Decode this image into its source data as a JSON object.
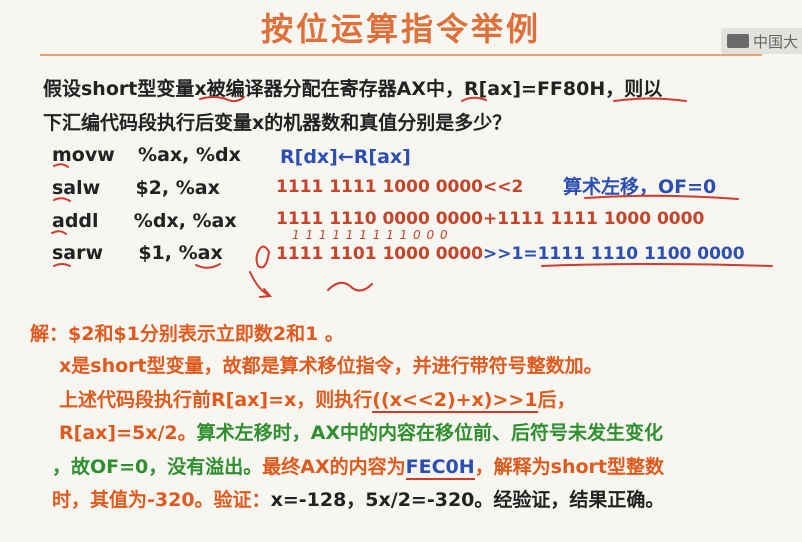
{
  "title": "按位运算指令举例",
  "logo_text": "中国大",
  "question": {
    "line1": "假设short型变量x被编译器分配在寄存器AX中，R[ax]=FF80H，则以",
    "line2": "下汇编代码段执行后变量x的机器数和真值分别是多少？"
  },
  "code": [
    {
      "op": "movw",
      "args": "%ax, %dx"
    },
    {
      "op": "salw",
      "args": "$2, %ax"
    },
    {
      "op": "addl",
      "args": "%dx, %ax"
    },
    {
      "op": "sarw",
      "args": "$1, %ax"
    }
  ],
  "explain": {
    "movw": "R[dx]←R[ax]",
    "salw": "1111 1111 1000 0000<<2",
    "salw_note": "算术左移，OF=0",
    "addl": "1111 1110 0000 0000+1111 1111 1000 0000",
    "sarw_left": "1111 1101 1000 0000",
    "sarw_op": ">>1=",
    "sarw_result": "1111 1110 1100 0000",
    "handwritten": "1 1 1 1 1 1 1 1 1 0 0 0"
  },
  "solution": {
    "line1": "解：$2和$1分别表示立即数2和1 。",
    "line2": "x是short型变量，故都是算术移位指令，并进行带符号整数加。",
    "line3_a": "上述代码段执行前R[ax]=x，则执行",
    "line3_b": "((x<<2)+x)>>1",
    "line3_c": "后，",
    "line4_a": "R[ax]=5x/2。",
    "line4_b": "算术左移时，AX中的内容在移位前、后符号未发生变化",
    "line5_a": "，故OF=0，没有溢出。",
    "line5_b": "最终AX的内容为",
    "line5_c": "FEC0H",
    "line5_d": "，解释为short型整数",
    "line6_a": "时，其值为-320。验证：",
    "line6_b": "x=-128，5x/2=-320。经验证，结果正确。"
  }
}
